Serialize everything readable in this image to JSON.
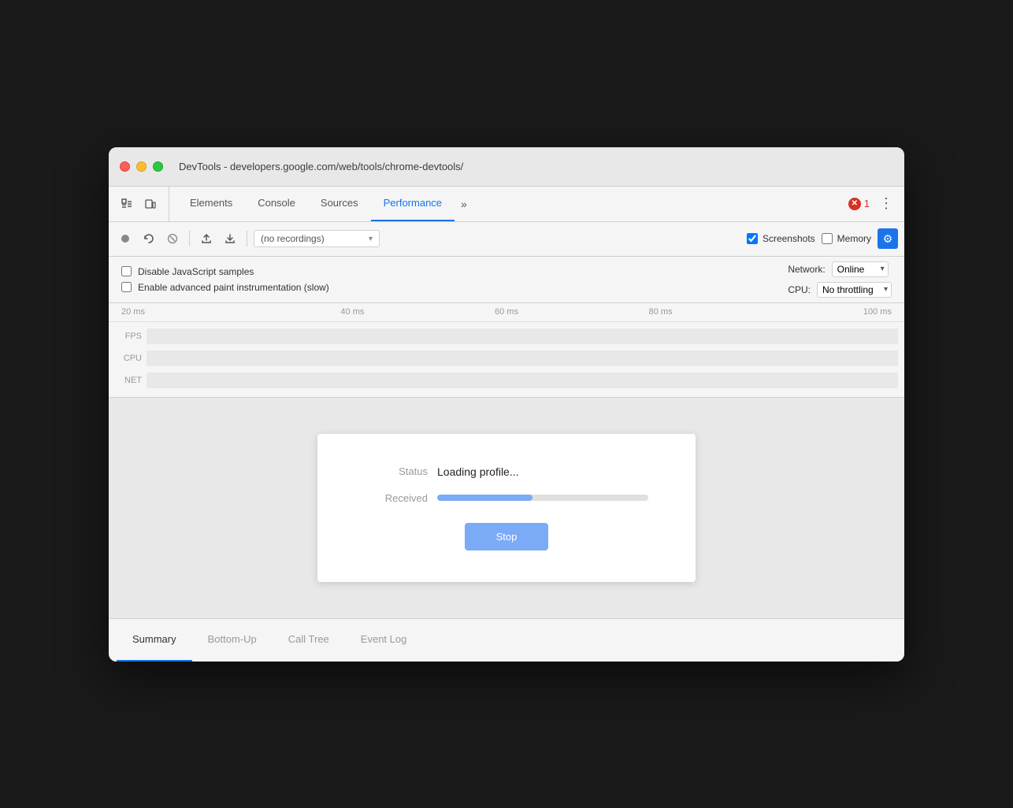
{
  "window": {
    "title": "DevTools - developers.google.com/web/tools/chrome-devtools/"
  },
  "tabs": {
    "items": [
      {
        "label": "Elements",
        "active": false
      },
      {
        "label": "Console",
        "active": false
      },
      {
        "label": "Sources",
        "active": false
      },
      {
        "label": "Performance",
        "active": true
      }
    ],
    "more_label": "»",
    "error_count": "1",
    "menu_label": "⋮"
  },
  "toolbar": {
    "record_title": "Record",
    "reload_title": "Reload and start recording",
    "clear_title": "Clear",
    "upload_title": "Load profile",
    "download_title": "Save profile",
    "recordings_placeholder": "(no recordings)",
    "screenshots_label": "Screenshots",
    "memory_label": "Memory",
    "gear_title": "Capture settings"
  },
  "settings": {
    "disable_js_label": "Disable JavaScript samples",
    "enable_paint_label": "Enable advanced paint instrumentation (slow)",
    "network_label": "Network:",
    "network_value": "Online",
    "cpu_label": "CPU:",
    "cpu_value": "No throttling"
  },
  "timeline": {
    "marks": [
      "20 ms",
      "40 ms",
      "60 ms",
      "80 ms",
      "100 ms"
    ],
    "fps_label": "FPS",
    "cpu_label": "CPU",
    "net_label": "NET"
  },
  "dialog": {
    "status_label": "Status",
    "status_value": "Loading profile...",
    "received_label": "Received",
    "progress_percent": 45,
    "stop_label": "Stop"
  },
  "bottom_tabs": {
    "items": [
      {
        "label": "Summary",
        "active": true
      },
      {
        "label": "Bottom-Up",
        "active": false
      },
      {
        "label": "Call Tree",
        "active": false
      },
      {
        "label": "Event Log",
        "active": false
      }
    ]
  }
}
